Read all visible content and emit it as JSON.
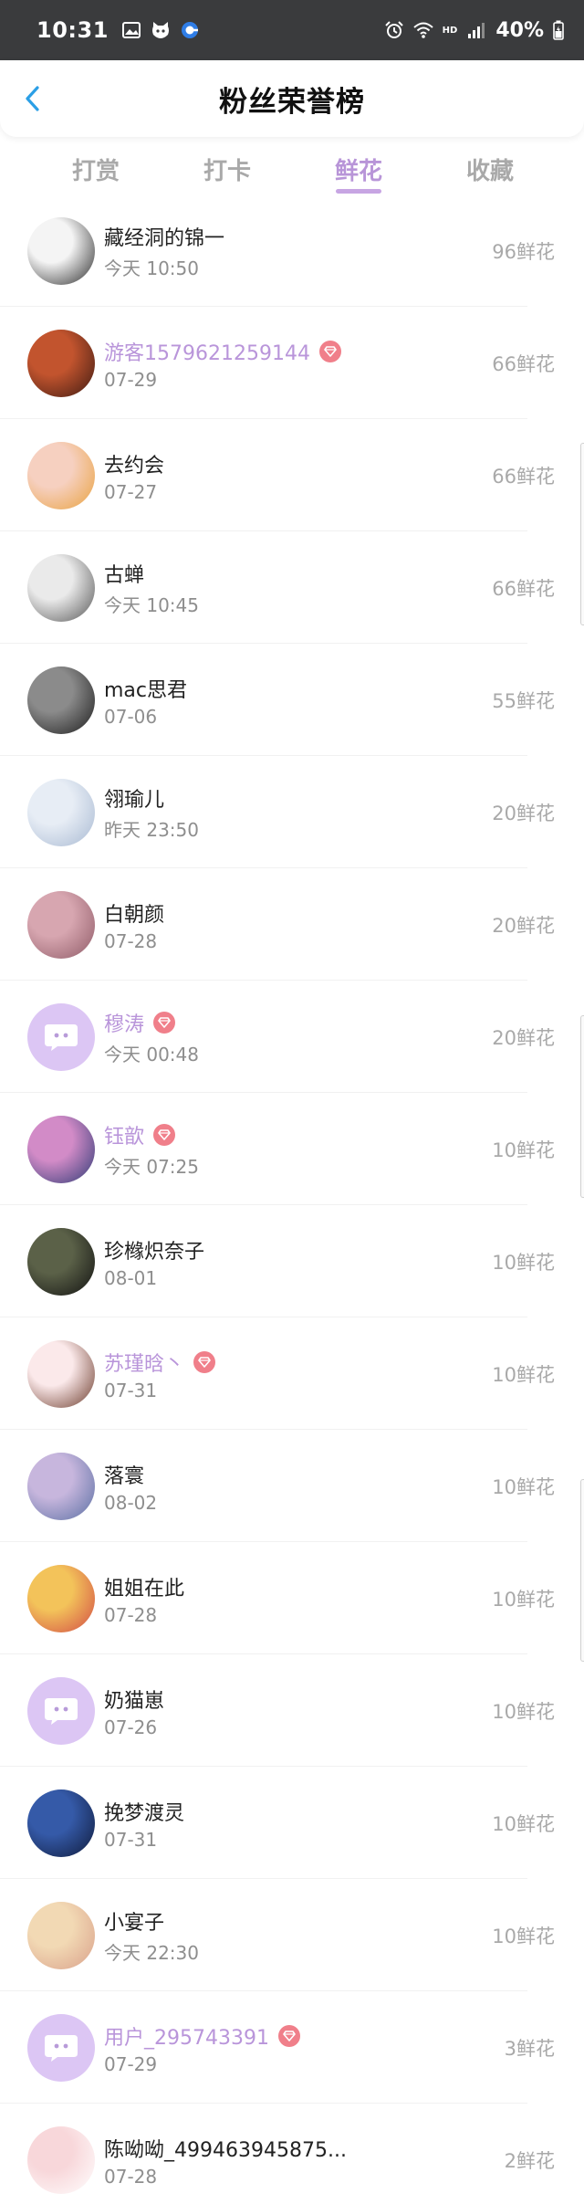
{
  "status_bar": {
    "time": "10:31",
    "battery": "40%",
    "left_icons": [
      "image-icon",
      "cat-icon",
      "browser-icon"
    ],
    "right_icons": [
      "alarm-icon",
      "wifi-icon",
      "signal-icon",
      "battery-icon"
    ],
    "hd_label": "HD"
  },
  "header": {
    "title": "粉丝荣誉榜",
    "back_icon": "chevron-left-icon"
  },
  "tabs": [
    {
      "label": "打赏",
      "active": false
    },
    {
      "label": "打卡",
      "active": false
    },
    {
      "label": "鲜花",
      "active": true
    },
    {
      "label": "收藏",
      "active": false
    }
  ],
  "colors": {
    "accent": "#b895d8",
    "vip_badge": "#f07f8a",
    "default_avatar": "#dcc6f4",
    "status_bar": "#3a3b3d"
  },
  "fans": [
    {
      "name": "藏经洞的锦一",
      "time": "今天 10:50",
      "count": "96鲜花",
      "vip": false,
      "avatar": "photo",
      "palette": [
        "#f4f4f4",
        "#2b2b2b"
      ]
    },
    {
      "name": "游客1579621259144",
      "time": "07-29",
      "count": "66鲜花",
      "vip": true,
      "avatar": "photo",
      "palette": [
        "#c2542e",
        "#3d1a12"
      ]
    },
    {
      "name": "去约会",
      "time": "07-27",
      "count": "66鲜花",
      "vip": false,
      "avatar": "photo",
      "palette": [
        "#f6d0c0",
        "#e9a23f"
      ]
    },
    {
      "name": "古蝉",
      "time": "今天 10:45",
      "count": "66鲜花",
      "vip": false,
      "avatar": "photo",
      "palette": [
        "#eaeaea",
        "#555555"
      ]
    },
    {
      "name": "mac思君",
      "time": "07-06",
      "count": "55鲜花",
      "vip": false,
      "avatar": "photo",
      "palette": [
        "#8b8b8b",
        "#1c1c1c"
      ]
    },
    {
      "name": "翎瑜儿",
      "time": "昨天 23:50",
      "count": "20鲜花",
      "vip": false,
      "avatar": "photo",
      "palette": [
        "#e7edf5",
        "#a8b9d2"
      ]
    },
    {
      "name": "白朝颜",
      "time": "07-28",
      "count": "20鲜花",
      "vip": false,
      "avatar": "photo",
      "palette": [
        "#d7a6b0",
        "#8e5a66"
      ]
    },
    {
      "name": "穆涛",
      "time": "今天 00:48",
      "count": "20鲜花",
      "vip": true,
      "avatar": "default",
      "palette": [
        "#dcc6f4",
        "#ffffff"
      ]
    },
    {
      "name": "钰歆",
      "time": "今天 07:25",
      "count": "10鲜花",
      "vip": true,
      "avatar": "photo",
      "palette": [
        "#d28bc7",
        "#2d3a75"
      ]
    },
    {
      "name": "珍橼炽奈子",
      "time": "08-01",
      "count": "10鲜花",
      "vip": false,
      "avatar": "photo",
      "palette": [
        "#5b6148",
        "#111111"
      ]
    },
    {
      "name": "苏瑾晗丶",
      "time": "07-31",
      "count": "10鲜花",
      "vip": true,
      "avatar": "photo",
      "palette": [
        "#fbe9ea",
        "#6b3a2a"
      ]
    },
    {
      "name": "落寰",
      "time": "08-02",
      "count": "10鲜花",
      "vip": false,
      "avatar": "photo",
      "palette": [
        "#c7b6dd",
        "#5a6fa3"
      ]
    },
    {
      "name": "姐姐在此",
      "time": "07-28",
      "count": "10鲜花",
      "vip": false,
      "avatar": "photo",
      "palette": [
        "#f3c35a",
        "#d24a45"
      ]
    },
    {
      "name": "奶猫崽",
      "time": "07-26",
      "count": "10鲜花",
      "vip": false,
      "avatar": "default",
      "palette": [
        "#dcc6f4",
        "#ffffff"
      ]
    },
    {
      "name": "挽梦渡灵",
      "time": "07-31",
      "count": "10鲜花",
      "vip": false,
      "avatar": "photo",
      "palette": [
        "#355aa8",
        "#0f1a3a"
      ]
    },
    {
      "name": "小宴子",
      "time": "今天 22:30",
      "count": "10鲜花",
      "vip": false,
      "avatar": "photo",
      "palette": [
        "#f2d9b4",
        "#d9a08a"
      ]
    },
    {
      "name": "用户_295743391",
      "time": "07-29",
      "count": "3鲜花",
      "vip": true,
      "avatar": "default",
      "palette": [
        "#dcc6f4",
        "#ffffff"
      ]
    },
    {
      "name": "陈呦呦_499463945875...",
      "time": "07-28",
      "count": "2鲜花",
      "vip": false,
      "avatar": "photo",
      "palette": [
        "#f8d7da",
        "#ffffff"
      ]
    }
  ]
}
